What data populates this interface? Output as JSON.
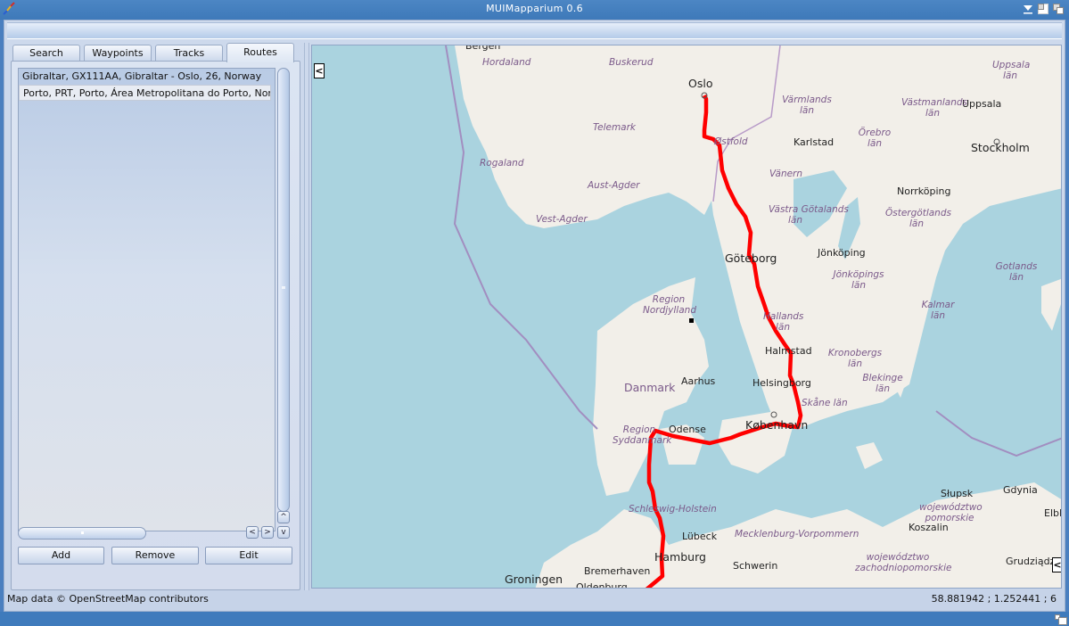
{
  "window": {
    "title": "MUIMapparium 0.6",
    "icons": [
      "app-icon",
      "iconify-icon",
      "zoom-icon",
      "depth-icon"
    ]
  },
  "tabs": [
    {
      "label": "Search",
      "active": false
    },
    {
      "label": "Waypoints",
      "active": false
    },
    {
      "label": "Tracks",
      "active": false
    },
    {
      "label": "Routes",
      "active": true
    }
  ],
  "routes": {
    "items": [
      {
        "label": "Gibraltar, GX111AA, Gibraltar - Oslo, 26, Norway",
        "selected": false
      },
      {
        "label": "Porto, PRT, Porto, Área Metropolitana do Porto, Norway",
        "selected": true
      }
    ],
    "buttons": {
      "add": "Add",
      "remove": "Remove",
      "edit": "Edit"
    },
    "scroll_icons": {
      "up": "^",
      "down": "v",
      "left": "<",
      "right": ">"
    }
  },
  "map": {
    "collapse_left_label": "<",
    "collapse_right_label": "<",
    "route_color": "#ff0000",
    "water_color": "#aad3df",
    "land_color": "#f2efe9",
    "labels": {
      "cities": [
        {
          "name": "Bergen"
        },
        {
          "name": "Oslo"
        },
        {
          "name": "Karlstad"
        },
        {
          "name": "Uppsala"
        },
        {
          "name": "Stockholm"
        },
        {
          "name": "Norrköping"
        },
        {
          "name": "Göteborg"
        },
        {
          "name": "Jönköping"
        },
        {
          "name": "Halmstad"
        },
        {
          "name": "Helsingborg"
        },
        {
          "name": "Aarhus"
        },
        {
          "name": "Odense"
        },
        {
          "name": "København"
        },
        {
          "name": "Lübeck"
        },
        {
          "name": "Hamburg"
        },
        {
          "name": "Schwerin"
        },
        {
          "name": "Bremerhaven"
        },
        {
          "name": "Oldenburg"
        },
        {
          "name": "Groningen"
        },
        {
          "name": "Słupsk"
        },
        {
          "name": "Gdynia"
        },
        {
          "name": "Koszalin"
        },
        {
          "name": "Elbląg"
        },
        {
          "name": "Grudziądz"
        }
      ],
      "regions": [
        {
          "name": "Hordaland"
        },
        {
          "name": "Buskerud"
        },
        {
          "name": "Telemark"
        },
        {
          "name": "Rogaland"
        },
        {
          "name": "Aust-Agder"
        },
        {
          "name": "Vest-Agder"
        },
        {
          "name": "Østfold"
        },
        {
          "name": "Värmlands län"
        },
        {
          "name": "Västmanlands län"
        },
        {
          "name": "Uppsala län"
        },
        {
          "name": "Örebro län"
        },
        {
          "name": "Vänern"
        },
        {
          "name": "Västra Götalands län"
        },
        {
          "name": "Östergötlands län"
        },
        {
          "name": "Jönköpings län"
        },
        {
          "name": "Hallands län"
        },
        {
          "name": "Kronobergs län"
        },
        {
          "name": "Kalmar län"
        },
        {
          "name": "Gotlands län"
        },
        {
          "name": "Blekinge län"
        },
        {
          "name": "Skåne län"
        },
        {
          "name": "Region Nordjylland"
        },
        {
          "name": "Region Syddanmark"
        },
        {
          "name": "Schleswig-Holstein"
        },
        {
          "name": "Mecklenburg-Vorpommern"
        },
        {
          "name": "województwo pomorskie"
        },
        {
          "name": "województwo zachodniopomorskie"
        }
      ],
      "countries": [
        {
          "name": "Danmark"
        }
      ]
    }
  },
  "status": {
    "attribution": "Map data © OpenStreetMap contributors",
    "coordinates": "58.881942 ; 1.252441 ; 6"
  }
}
